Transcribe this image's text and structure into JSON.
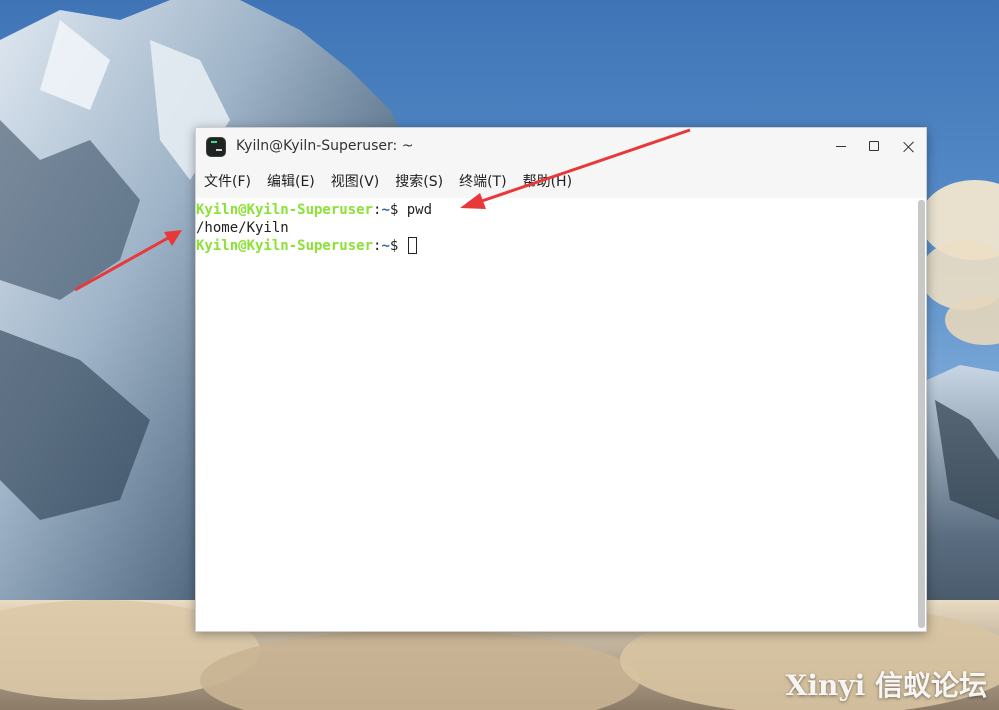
{
  "window": {
    "title": "Kyiln@Kyiln-Superuser: ~",
    "app_icon": "terminal-icon",
    "controls": [
      "minimize-icon",
      "maximize-icon",
      "close-icon"
    ]
  },
  "menubar": {
    "items": [
      {
        "label": "文件(F)"
      },
      {
        "label": "编辑(E)"
      },
      {
        "label": "视图(V)"
      },
      {
        "label": "搜索(S)"
      },
      {
        "label": "终端(T)"
      },
      {
        "label": "帮助(H)"
      }
    ]
  },
  "terminal": {
    "lines": [
      {
        "user": "Kyiln@Kyiln-Superuser",
        "colon": ":",
        "path": "~",
        "symbol": "$ ",
        "command": "pwd"
      },
      {
        "output": "/home/Kyiln"
      },
      {
        "user": "Kyiln@Kyiln-Superuser",
        "colon": ":",
        "path": "~",
        "symbol": "$ ",
        "command": ""
      }
    ]
  },
  "annotations": {
    "arrow_color": "#e8383a"
  },
  "watermark": {
    "text": "Xinyi 信蚁论坛"
  },
  "colors": {
    "prompt_user": "#8ae234",
    "prompt_path": "#3465a4",
    "window_chrome": "#f6f6f6"
  }
}
